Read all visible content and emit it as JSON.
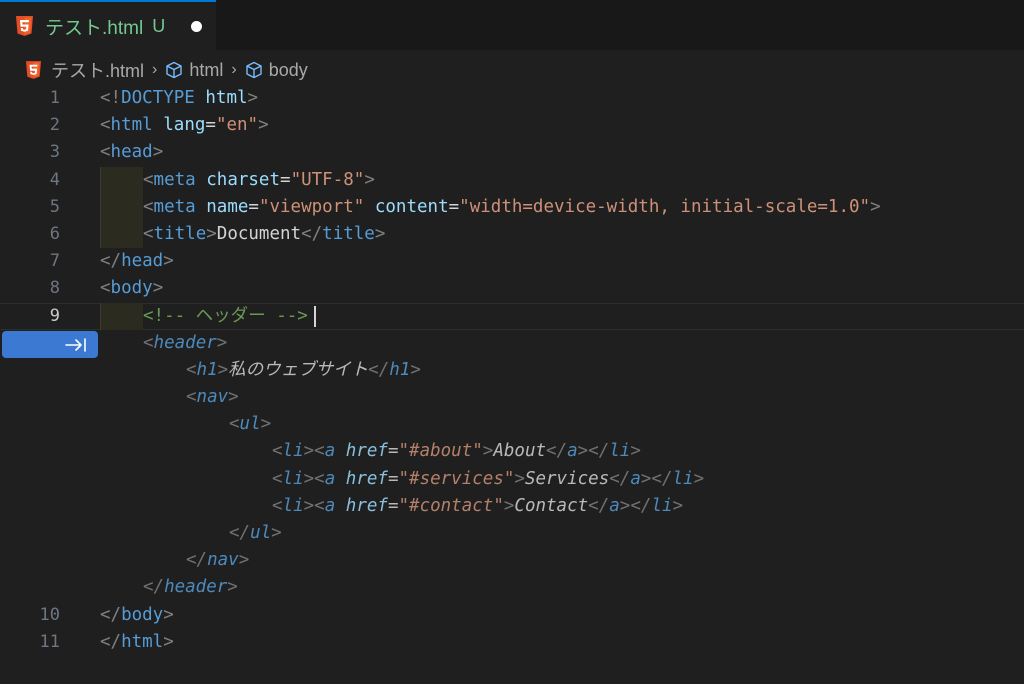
{
  "tab": {
    "title": "テスト.html",
    "status": "U",
    "icon": "html5-icon"
  },
  "breadcrumb": {
    "file": "テスト.html",
    "items": [
      "html",
      "body"
    ]
  },
  "colors": {
    "background": "#1f1f1f",
    "tab_modified_text": "#73c991",
    "accept_button": "#3b79d3",
    "tag": "#569cd6",
    "attribute": "#9cdcfe",
    "string": "#ce9178",
    "comment": "#6a9955"
  },
  "editor": {
    "current_line": "9",
    "lines": [
      {
        "num": "1",
        "tokens": [
          [
            "punct",
            "<!"
          ],
          [
            "tag",
            "DOCTYPE"
          ],
          [
            "text",
            " "
          ],
          [
            "attr",
            "html"
          ],
          [
            "punct",
            ">"
          ]
        ]
      },
      {
        "num": "2",
        "tokens": [
          [
            "punct",
            "<"
          ],
          [
            "tag",
            "html"
          ],
          [
            "text",
            " "
          ],
          [
            "attr",
            "lang"
          ],
          [
            "text",
            "="
          ],
          [
            "str",
            "\"en\""
          ],
          [
            "punct",
            ">"
          ]
        ]
      },
      {
        "num": "3",
        "tokens": [
          [
            "punct",
            "<"
          ],
          [
            "tag",
            "head"
          ],
          [
            "punct",
            ">"
          ]
        ]
      },
      {
        "num": "4",
        "tokens": [
          [
            "punct",
            "<"
          ],
          [
            "tag",
            "meta"
          ],
          [
            "text",
            " "
          ],
          [
            "attr",
            "charset"
          ],
          [
            "text",
            "="
          ],
          [
            "str",
            "\"UTF-8\""
          ],
          [
            "punct",
            ">"
          ]
        ]
      },
      {
        "num": "5",
        "tokens": [
          [
            "punct",
            "<"
          ],
          [
            "tag",
            "meta"
          ],
          [
            "text",
            " "
          ],
          [
            "attr",
            "name"
          ],
          [
            "text",
            "="
          ],
          [
            "str",
            "\"viewport\""
          ],
          [
            "text",
            " "
          ],
          [
            "attr",
            "content"
          ],
          [
            "text",
            "="
          ],
          [
            "str",
            "\"width=device-width, initial-scale=1.0\""
          ],
          [
            "punct",
            ">"
          ]
        ]
      },
      {
        "num": "6",
        "tokens": [
          [
            "punct",
            "<"
          ],
          [
            "tag",
            "title"
          ],
          [
            "punct",
            ">"
          ],
          [
            "text",
            "Document"
          ],
          [
            "punct",
            "</"
          ],
          [
            "tag",
            "title"
          ],
          [
            "punct",
            ">"
          ]
        ]
      },
      {
        "num": "7",
        "tokens": [
          [
            "punct",
            "</"
          ],
          [
            "tag",
            "head"
          ],
          [
            "punct",
            ">"
          ]
        ]
      },
      {
        "num": "8",
        "tokens": [
          [
            "punct",
            "<"
          ],
          [
            "tag",
            "body"
          ],
          [
            "punct",
            ">"
          ]
        ]
      },
      {
        "num": "9",
        "tokens": [
          [
            "comment",
            "<!-- ヘッダー -->"
          ]
        ]
      },
      {
        "num": "",
        "ghost": true,
        "tokens": [
          [
            "punct",
            "<"
          ],
          [
            "tag",
            "header"
          ],
          [
            "punct",
            ">"
          ]
        ]
      },
      {
        "num": "",
        "ghost": true,
        "tokens": [
          [
            "punct",
            "<"
          ],
          [
            "tag",
            "h1"
          ],
          [
            "punct",
            ">"
          ],
          [
            "text",
            "私のウェブサイト"
          ],
          [
            "punct",
            "</"
          ],
          [
            "tag",
            "h1"
          ],
          [
            "punct",
            ">"
          ]
        ]
      },
      {
        "num": "",
        "ghost": true,
        "tokens": [
          [
            "punct",
            "<"
          ],
          [
            "tag",
            "nav"
          ],
          [
            "punct",
            ">"
          ]
        ]
      },
      {
        "num": "",
        "ghost": true,
        "tokens": [
          [
            "punct",
            "<"
          ],
          [
            "tag",
            "ul"
          ],
          [
            "punct",
            ">"
          ]
        ]
      },
      {
        "num": "",
        "ghost": true,
        "tokens": [
          [
            "punct",
            "<"
          ],
          [
            "tag",
            "li"
          ],
          [
            "punct",
            "><"
          ],
          [
            "tag",
            "a"
          ],
          [
            "text",
            " "
          ],
          [
            "attr",
            "href"
          ],
          [
            "text",
            "="
          ],
          [
            "str",
            "\"#about\""
          ],
          [
            "punct",
            ">"
          ],
          [
            "text",
            "About"
          ],
          [
            "punct",
            "</"
          ],
          [
            "tag",
            "a"
          ],
          [
            "punct",
            "></"
          ],
          [
            "tag",
            "li"
          ],
          [
            "punct",
            ">"
          ]
        ]
      },
      {
        "num": "",
        "ghost": true,
        "tokens": [
          [
            "punct",
            "<"
          ],
          [
            "tag",
            "li"
          ],
          [
            "punct",
            "><"
          ],
          [
            "tag",
            "a"
          ],
          [
            "text",
            " "
          ],
          [
            "attr",
            "href"
          ],
          [
            "text",
            "="
          ],
          [
            "str",
            "\"#services\""
          ],
          [
            "punct",
            ">"
          ],
          [
            "text",
            "Services"
          ],
          [
            "punct",
            "</"
          ],
          [
            "tag",
            "a"
          ],
          [
            "punct",
            "></"
          ],
          [
            "tag",
            "li"
          ],
          [
            "punct",
            ">"
          ]
        ]
      },
      {
        "num": "",
        "ghost": true,
        "tokens": [
          [
            "punct",
            "<"
          ],
          [
            "tag",
            "li"
          ],
          [
            "punct",
            "><"
          ],
          [
            "tag",
            "a"
          ],
          [
            "text",
            " "
          ],
          [
            "attr",
            "href"
          ],
          [
            "text",
            "="
          ],
          [
            "str",
            "\"#contact\""
          ],
          [
            "punct",
            ">"
          ],
          [
            "text",
            "Contact"
          ],
          [
            "punct",
            "</"
          ],
          [
            "tag",
            "a"
          ],
          [
            "punct",
            "></"
          ],
          [
            "tag",
            "li"
          ],
          [
            "punct",
            ">"
          ]
        ]
      },
      {
        "num": "",
        "ghost": true,
        "tokens": [
          [
            "punct",
            "</"
          ],
          [
            "tag",
            "ul"
          ],
          [
            "punct",
            ">"
          ]
        ]
      },
      {
        "num": "",
        "ghost": true,
        "tokens": [
          [
            "punct",
            "</"
          ],
          [
            "tag",
            "nav"
          ],
          [
            "punct",
            ">"
          ]
        ]
      },
      {
        "num": "",
        "ghost": true,
        "tokens": [
          [
            "punct",
            "</"
          ],
          [
            "tag",
            "header"
          ],
          [
            "punct",
            ">"
          ]
        ]
      },
      {
        "num": "10",
        "tokens": [
          [
            "punct",
            "</"
          ],
          [
            "tag",
            "body"
          ],
          [
            "punct",
            ">"
          ]
        ]
      },
      {
        "num": "11",
        "tokens": [
          [
            "punct",
            "</"
          ],
          [
            "tag",
            "html"
          ],
          [
            "punct",
            ">"
          ]
        ]
      }
    ]
  },
  "inline_suggestion": {
    "accept_icon": "tab-accept-icon"
  }
}
